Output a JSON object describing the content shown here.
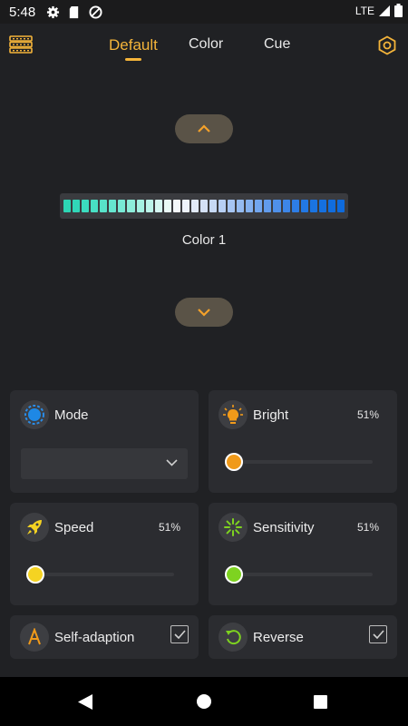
{
  "status": {
    "time": "5:48",
    "network": "LTE"
  },
  "tabs": [
    {
      "label": "Default",
      "active": true
    },
    {
      "label": "Color",
      "active": false
    },
    {
      "label": "Cue",
      "active": false
    }
  ],
  "preview": {
    "color_label": "Color 1",
    "leds": [
      "#2dd6b4",
      "#31d6b8",
      "#3bdcbf",
      "#48dfc4",
      "#58e2c9",
      "#66e6cf",
      "#78e9d5",
      "#8dedda",
      "#a5f1e2",
      "#bcf4ea",
      "#d6f7f1",
      "#eaf9f6",
      "#f4f8fb",
      "#eef2fb",
      "#e2eaf8",
      "#d5e1f6",
      "#c7d9f4",
      "#b7cff3",
      "#a6c5f2",
      "#95bbf0",
      "#84b1ef",
      "#72a6ee",
      "#619bec",
      "#4f90ea",
      "#3d86e8",
      "#2d7de6",
      "#2278e4",
      "#1a74e2",
      "#1570e0",
      "#116dde",
      "#0e6adc"
    ]
  },
  "controls": {
    "mode": {
      "title": "Mode",
      "selected": ""
    },
    "bright": {
      "title": "Bright",
      "value": "51%",
      "level": 0.0,
      "thumb_color": "#f09a1a"
    },
    "speed": {
      "title": "Speed",
      "value": "51%",
      "level": 0.0,
      "thumb_color": "#f5d322"
    },
    "sensitivity": {
      "title": "Sensitivity",
      "value": "51%",
      "level": 0.0,
      "thumb_color": "#7ed320"
    },
    "self_adaption": {
      "title": "Self-adaption",
      "checked": true
    },
    "reverse": {
      "title": "Reverse",
      "checked": true
    }
  },
  "colors": {
    "accent": "#f4b43a",
    "card": "#2b2c30",
    "background": "#202124"
  }
}
